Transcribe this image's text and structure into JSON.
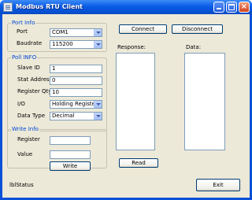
{
  "window": {
    "title": "Modbus RTU Client"
  },
  "port_info": {
    "legend": "Port Info",
    "port_label": "Port",
    "port_value": "COM1",
    "baudrate_label": "Baudrate",
    "baudrate_value": "115200"
  },
  "poll_info": {
    "legend": "Poll INFO",
    "slave_id_label": "Slave ID",
    "slave_id_value": "1",
    "start_address_label": "Stat Address",
    "start_address_value": "0",
    "register_qty_label": "Register Qty",
    "register_qty_value": "10",
    "io_label": "I/O",
    "io_value": "Holding Register",
    "data_type_label": "Data Type",
    "data_type_value": "Decimal"
  },
  "write_info": {
    "legend": "Write Info",
    "register_label": "Register",
    "register_value": "",
    "value_label": "Value",
    "value_value": "",
    "write_button": "Write"
  },
  "toolbar": {
    "connect_label": "Connect",
    "disconnect_label": "Disconnect"
  },
  "response": {
    "label": "Response:"
  },
  "data_panel": {
    "label": "Data:"
  },
  "read_button": "Read",
  "status": {
    "text": "lblStatus"
  },
  "exit_button": "Exit"
}
